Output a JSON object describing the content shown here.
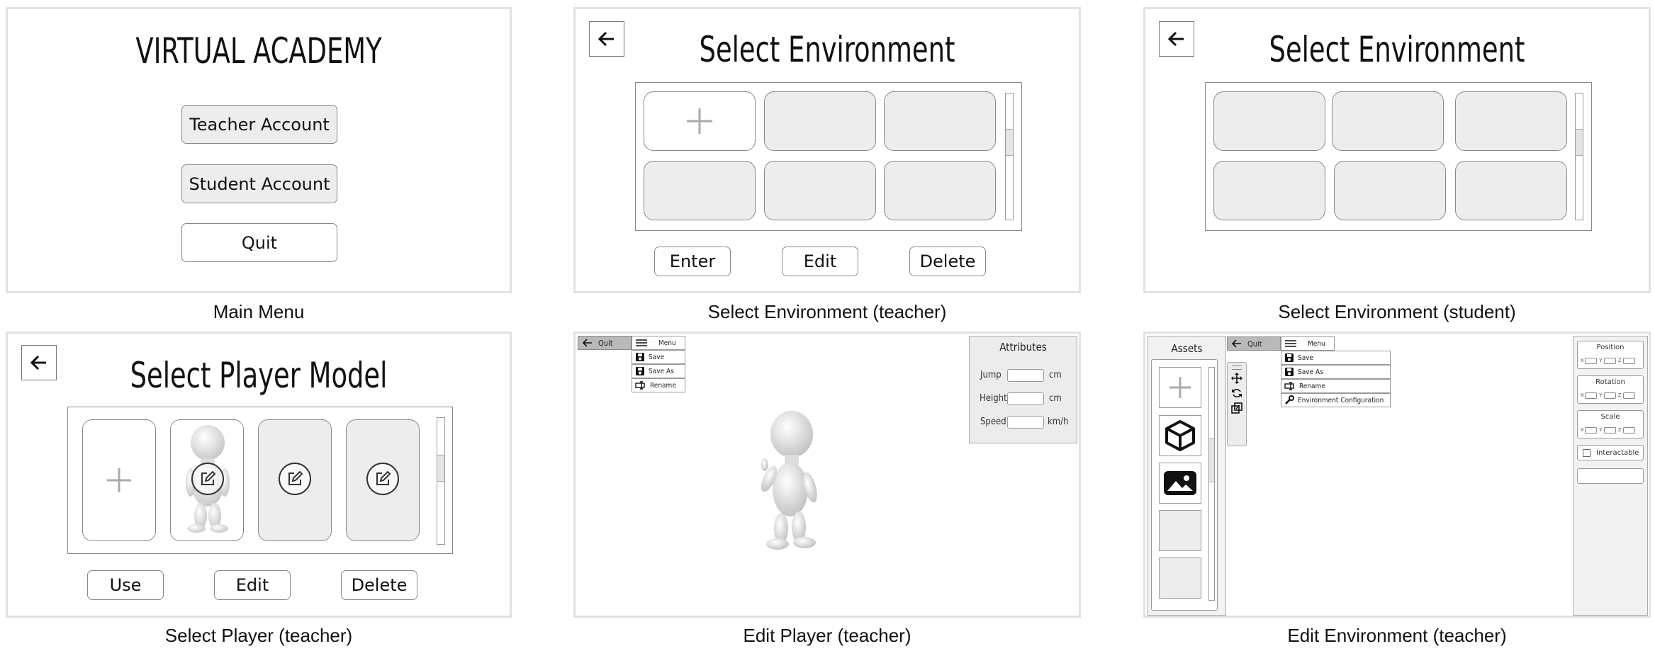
{
  "captions": {
    "main_menu": "Main Menu",
    "select_env_teacher": "Select Environment (teacher)",
    "select_env_student": "Select Environment (student)",
    "select_player_teacher": "Select Player (teacher)",
    "edit_player_teacher": "Edit Player (teacher)",
    "edit_env_teacher": "Edit Environment (teacher)"
  },
  "main_menu": {
    "title": "VIRTUAL ACADEMY",
    "teacher_account": "Teacher Account",
    "student_account": "Student Account",
    "quit": "Quit"
  },
  "select_env_teacher": {
    "title": "Select Environment",
    "enter": "Enter",
    "edit": "Edit",
    "delete": "Delete"
  },
  "select_env_student": {
    "title": "Select Environment"
  },
  "select_player": {
    "title": "Select Player Model",
    "use": "Use",
    "edit": "Edit",
    "delete": "Delete"
  },
  "edit_player": {
    "quit": "Quit",
    "menu": "Menu",
    "menu_items": [
      "Save",
      "Save As",
      "Rename"
    ],
    "attributes_title": "Attributes",
    "jump": "Jump",
    "height": "Height",
    "speed": "Speed",
    "unit_cm": "cm",
    "unit_cm2": "cm",
    "unit_kmh": "km/h"
  },
  "edit_env": {
    "assets": "Assets",
    "quit": "Quit",
    "menu": "Menu",
    "menu_items": [
      "Save",
      "Save As",
      "Rename",
      "Environment Configuration"
    ],
    "position": "Position",
    "rotation": "Rotation",
    "scale": "Scale",
    "interactable": "Interactable",
    "axes": [
      "X",
      "Y",
      "Z"
    ]
  },
  "icons": {
    "back": "back-arrow-icon",
    "add": "plus-icon",
    "edit": "edit-icon",
    "menu": "hamburger-icon",
    "save": "floppy-icon",
    "rename": "rename-icon",
    "config": "wrench-icon",
    "move": "move-icon",
    "rotate": "rotate-icon",
    "scale": "scale-icon",
    "cube": "cube-icon",
    "image": "image-icon"
  }
}
